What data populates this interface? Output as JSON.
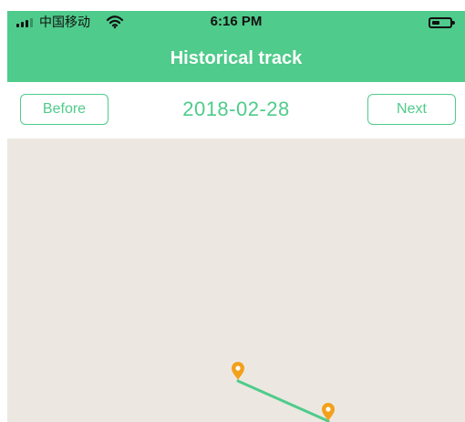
{
  "status_bar": {
    "carrier": "中国移动",
    "time": "6:16 PM",
    "signal_icon": "signal-bars-icon",
    "wifi_icon": "wifi-icon",
    "battery_icon": "battery-icon"
  },
  "header": {
    "title": "Historical track",
    "background_color": "#4fcb8b"
  },
  "date_navigation": {
    "previous_label": "Before",
    "current_date": "2018-02-28",
    "next_label": "Next",
    "accent_color": "#4fcb8b"
  },
  "map": {
    "background_color": "#ece8e1",
    "route_color": "#4fcb8b",
    "marker_color": "#f2a11b",
    "marker_icon": "location-pin-icon"
  }
}
